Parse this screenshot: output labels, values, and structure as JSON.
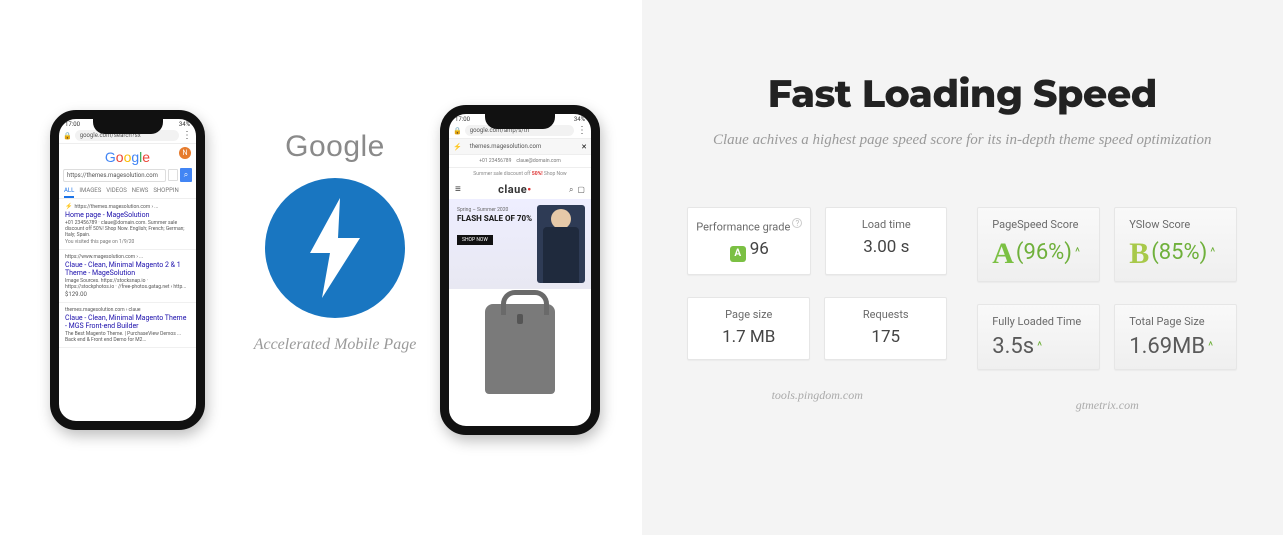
{
  "right": {
    "title": "Fast Loading Speed",
    "subtitle": "Claue achives a highest page speed score for its in-depth theme speed optimization",
    "pingdom": {
      "perf_label": "Performance grade",
      "perf_letter": "A",
      "perf_score": "96",
      "load_label": "Load time",
      "load_value": "3.00 s",
      "size_label": "Page size",
      "size_value": "1.7 MB",
      "req_label": "Requests",
      "req_value": "175",
      "source": "tools.pingdom.com"
    },
    "gtmetrix": {
      "ps_label": "PageSpeed Score",
      "ps_letter": "A",
      "ps_value": "(96%)",
      "ys_label": "YSlow Score",
      "ys_letter": "B",
      "ys_value": "(85%)",
      "flt_label": "Fully Loaded Time",
      "flt_value": "3.5s",
      "tps_label": "Total Page Size",
      "tps_value": "1.69MB",
      "source": "gtmetrix.com"
    }
  },
  "amp": {
    "word": "Google",
    "caption": "Accelerated Mobile Page"
  },
  "phone1": {
    "time": "17:00",
    "bat": "34%",
    "addr": "google.com/search?sx",
    "search": "https://themes.magesolution.com",
    "tabs": [
      "ALL",
      "IMAGES",
      "VIDEOS",
      "NEWS",
      "SHOPPIN"
    ],
    "avatar": "N",
    "r1": {
      "url": "https://themes.magesolution.com › ...",
      "title": "Home page - MageSolution",
      "desc": "+01 23456789 · claue@domain.com. Summer sale discount off 50%! Shop Now. English; French; German; Italy; Spain.",
      "visited": "You visited this page on 1/9/20"
    },
    "r2": {
      "url": "https://www.magesolution.com › ...",
      "title": "Claue - Clean, Minimal Magento 2 & 1 Theme - MageSolution",
      "desc": "Image Sources. https://stocksnap.io · https://stockphotos.io · //free-photos.gatag.net › http...",
      "price": "$129.00"
    },
    "r3": {
      "url": "themes.magesolution.com › claue",
      "title": "Claue - Clean, Minimal Magento Theme - MGS Front-end Builder",
      "desc": "The Best Magento Theme. | PurchaseView Demos ... Back end & Front end Demo for M2..."
    }
  },
  "phone2": {
    "time": "17:00",
    "bat": "34%",
    "addr": "google.com/amp/s/th",
    "addr2": "themes.magesolution.com",
    "contact": "+01 23456789",
    "email": "claue@domain.com",
    "promo_pre": "Summer sale discount off ",
    "promo_pct": "50%!",
    "promo_post": " Shop Now",
    "logo": "claue",
    "hero_pre": "Spring – Summer 2020",
    "hero_title": "FLASH SALE OF 70%",
    "hero_btn": "SHOP NOW"
  }
}
